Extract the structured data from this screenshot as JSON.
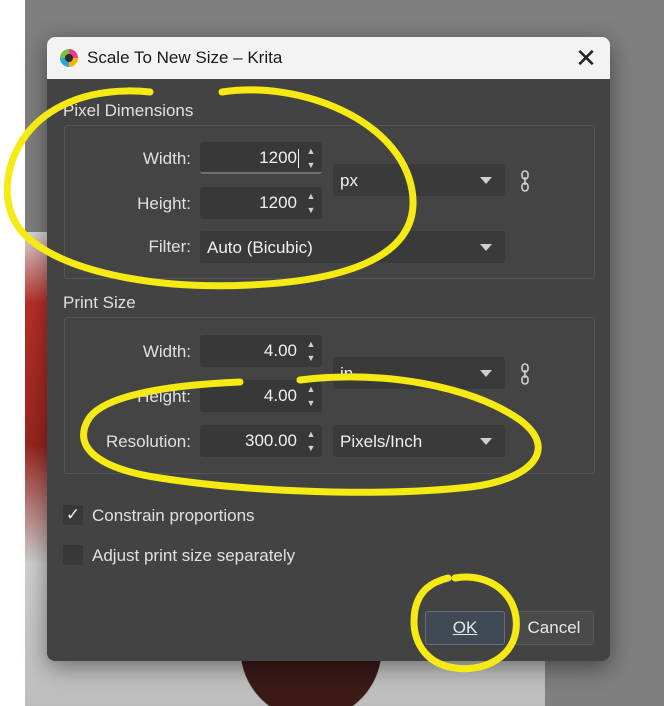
{
  "window": {
    "title": "Scale To New Size – Krita",
    "close_glyph": "✕",
    "app_icon": "krita-icon"
  },
  "pixel_dimensions": {
    "section_title": "Pixel Dimensions",
    "width_label": "Width:",
    "width_value": "1200",
    "height_label": "Height:",
    "height_value": "1200",
    "unit": "px",
    "filter_label": "Filter:",
    "filter_value": "Auto (Bicubic)"
  },
  "print_size": {
    "section_title": "Print Size",
    "width_label": "Width:",
    "width_value": "4.00",
    "height_label": "Height:",
    "height_value": "4.00",
    "unit": "in",
    "resolution_label": "Resolution:",
    "resolution_value": "300.00",
    "resolution_unit": "Pixels/Inch"
  },
  "options": {
    "constrain_label": "Constrain proportions",
    "constrain_checked": true,
    "adjust_label": "Adjust print size separately",
    "adjust_checked": false
  },
  "buttons": {
    "ok": "OK",
    "cancel": "Cancel"
  },
  "colors": {
    "dialog_bg": "#434343",
    "titlebar_bg": "#f3f3f3",
    "annotation": "#f5ea14"
  },
  "icons": {
    "link": "chain-link-icon",
    "spin": "spin-arrows-icon",
    "dropdown": "chevron-down-icon"
  }
}
